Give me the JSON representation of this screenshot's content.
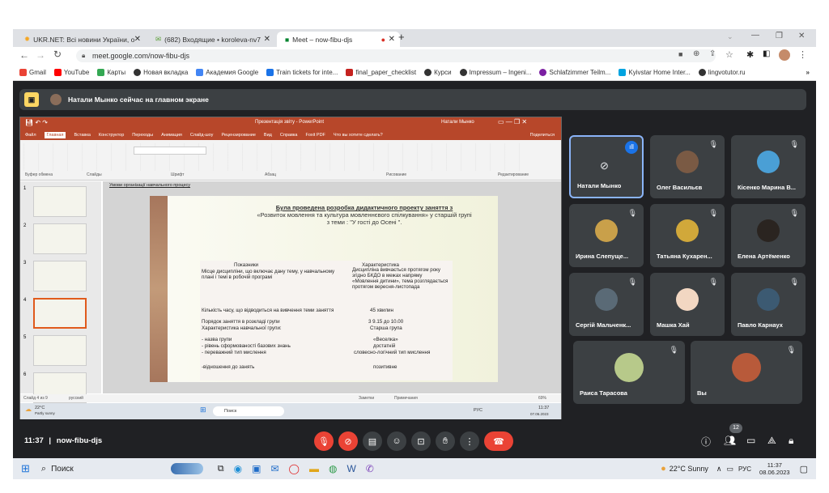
{
  "browser": {
    "tabs": [
      {
        "title": "UKR.NET: Всі новини України, о"
      },
      {
        "title": "(682) Входящие • koroleva-nv7"
      },
      {
        "title": "Meet – now-fibu-djs"
      }
    ],
    "new_tab": "+",
    "url": "meet.google.com/now-fibu-djs",
    "bookmarks": [
      {
        "label": "Gmail",
        "color": "#ea4335"
      },
      {
        "label": "YouTube",
        "color": "#ff0000"
      },
      {
        "label": "Карты",
        "color": "#34a853"
      },
      {
        "label": "Новая вкладка",
        "color": "#333333"
      },
      {
        "label": "Академия Google",
        "color": "#4285f4"
      },
      {
        "label": "Train tickets for inte...",
        "color": "#1a73e8"
      },
      {
        "label": "final_paper_checklist",
        "color": "#c5221f"
      },
      {
        "label": "Курси",
        "color": "#333333"
      },
      {
        "label": "Impressum – Ingeni...",
        "color": "#333333"
      },
      {
        "label": "Schlafzimmer Teilm...",
        "color": "#7b1fa2"
      },
      {
        "label": "Kyivstar Home Inter...",
        "color": "#00a3e0"
      },
      {
        "label": "lingvotutor.ru",
        "color": "#333333"
      }
    ]
  },
  "meet": {
    "banner": "Натали Мынко сейчас на главном экране",
    "tiles": [
      {
        "name": "Натали Мынко",
        "active": true
      },
      {
        "name": "Олег Васильєв"
      },
      {
        "name": "Кісенко Марина В..."
      },
      {
        "name": "Ирина Слепуще..."
      },
      {
        "name": "Татьяна Кухарен..."
      },
      {
        "name": "Елена Артёменко"
      },
      {
        "name": "Сергій Мальченк..."
      },
      {
        "name": "Машка Хай"
      },
      {
        "name": "Павло Карнаух"
      },
      {
        "name": "Раиса Тарасова"
      },
      {
        "name": "Вы"
      }
    ],
    "time": "11:37",
    "separator": "|",
    "meeting_code": "now-fibu-djs",
    "participants_count": "12"
  },
  "ppt": {
    "title": "Презентація звіту - PowerPoint",
    "user": "Натали Мынко",
    "tabs": [
      "Файл",
      "Главная",
      "Вставка",
      "Конструктор",
      "Переходы",
      "Анимация",
      "Слайд-шоу",
      "Рецензирование",
      "Вид",
      "Справка",
      "Foxit PDF",
      "Что вы хотите сделать?"
    ],
    "share": "Поделиться",
    "groups": [
      "Буфер обмена",
      "Слайды",
      "Шрифт",
      "Абзац",
      "Рисование",
      "Редактирование"
    ],
    "header_note": "Умови організації навчального процесу",
    "slide_title_l1": "Була проведена розробка дидактичного проекту заняття з",
    "slide_title_l2": "«Розвиток мовлення та культура мовленнєвого спілкування» у старшій групі",
    "slide_title_l3": "з теми : \"У гості до Осені \".",
    "table": {
      "headers": [
        "Показники",
        "Характеристика"
      ],
      "rows": [
        [
          "Місце дисципліни, що включає дану тему, у навчальному плані і темі в робочій програмі",
          "Дисципліна вивчається протягом року згідно БКДО в межах напряму «Мовлення дитини», тема розглядається протягом вересня-листопада"
        ],
        [
          "Кількість часу, що відводиться на вивчення теми заняття",
          "45 хвилин"
        ],
        [
          "Порядок заняття в розкладі групи",
          "3 9.15 до 10.00"
        ],
        [
          "Характеристика навчальної групи:",
          "Старша група"
        ],
        [
          "- назва групи",
          "«Веселка»"
        ],
        [
          "- рівень сформованості базових знань",
          "достатній"
        ],
        [
          "- переважний тип мислення",
          "словесно-логічний тип мислення"
        ],
        [
          "-відношення до занять",
          "позитивне"
        ]
      ]
    },
    "status_slide": "Слайд 4 из 9",
    "status_lang": "русский",
    "notes": "Заметки",
    "comments": "Примечания",
    "zoom": "69%",
    "slide_numbers": [
      "1",
      "2",
      "3",
      "4",
      "5",
      "6"
    ],
    "inner_weather_temp": "22°C",
    "inner_weather_desc": "Partly sunny",
    "inner_search": "Поиск",
    "inner_lang": "РУС",
    "inner_time": "11:37",
    "inner_date": "07.06.2023"
  },
  "taskbar": {
    "search": "Поиск",
    "weather": "22°C Sunny",
    "lang": "РУС",
    "time": "11:37",
    "date": "08.06.2023"
  }
}
